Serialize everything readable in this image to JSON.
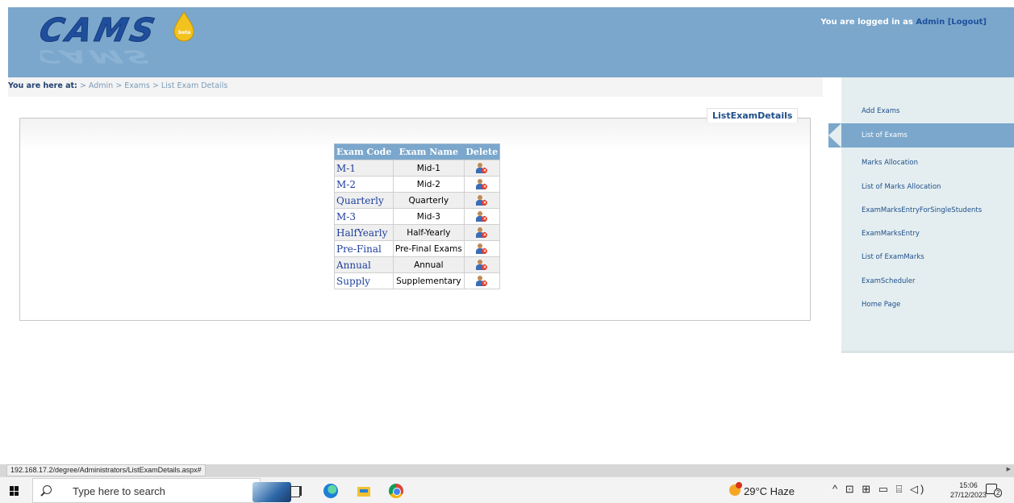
{
  "header": {
    "logo_text": "CAMS",
    "logo_badge": "beta",
    "login_prefix": "You are logged in as",
    "username": "Admin",
    "logout_label": "[Logout]"
  },
  "breadcrumb": {
    "label": "You are here at:",
    "sep": ">",
    "items": [
      "Admin",
      "Exams",
      "List Exam Details"
    ]
  },
  "sidebar": {
    "items": [
      {
        "label": "Add Exams"
      },
      {
        "label": "List of Exams",
        "active": true
      },
      {
        "label": "Marks Allocation"
      },
      {
        "label": "List of Marks Allocation"
      },
      {
        "label": "ExamMarksEntryForSingleStudents"
      },
      {
        "label": "ExamMarksEntry"
      },
      {
        "label": "List of ExamMarks"
      },
      {
        "label": "ExamScheduler"
      },
      {
        "label": "Home Page"
      }
    ]
  },
  "panel": {
    "title": "ListExamDetails"
  },
  "table": {
    "headers": [
      "Exam Code",
      "Exam Name",
      "Delete"
    ],
    "rows": [
      {
        "code": "M-1",
        "name": "Mid-1"
      },
      {
        "code": "M-2",
        "name": "Mid-2"
      },
      {
        "code": "Quarterly",
        "name": "Quarterly"
      },
      {
        "code": "M-3",
        "name": "Mid-3"
      },
      {
        "code": "HalfYearly",
        "name": "Half-Yearly"
      },
      {
        "code": "Pre-Final",
        "name": "Pre-Final Exams"
      },
      {
        "code": "Annual",
        "name": "Annual"
      },
      {
        "code": "Supply",
        "name": "Supplementary"
      }
    ]
  },
  "statusbar": {
    "url": "192.168.17.2/degree/Administrators/ListExamDetails.aspx#"
  },
  "taskbar": {
    "search_placeholder": "Type here to search",
    "weather": "29°C  Haze",
    "tray_glyphs": "^ ⊡ ⊞ ▭ ⌸ ◁)",
    "time": "15:06",
    "date": "27/12/2023",
    "notification_count": "2"
  },
  "colors": {
    "header_bg": "#7ba7cc",
    "link": "#1e3f9c",
    "sidebar_bg": "#e4eef0"
  }
}
